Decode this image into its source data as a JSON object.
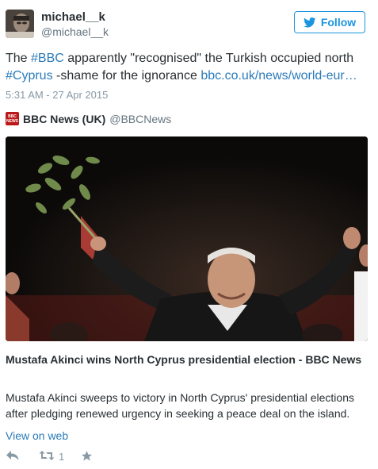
{
  "user": {
    "name": "michael__k",
    "handle": "@michael__k"
  },
  "follow_button": {
    "label": "Follow"
  },
  "tweet": {
    "text_1": "The ",
    "hashtag_bbc": "#BBC",
    "text_2": " apparently \"recognised\" the Turkish occupied north ",
    "hashtag_cyprus": "#Cyprus",
    "text_3": " -shame for the ignorance ",
    "link": "bbc.co.uk/news/world-eur…",
    "timestamp": "5:31 AM - 27 Apr 2015"
  },
  "source": {
    "logo_line1": "BBC",
    "logo_line2": "NEWS",
    "name": "BBC News (UK)",
    "handle": "@BBCNews"
  },
  "article": {
    "title": "Mustafa Akinci wins North Cyprus presidential election - BBC News",
    "description": "Mustafa Akinci sweeps to victory in North Cyprus' presidential elections after pledging renewed urgency in seeking a peace deal on the island.",
    "view_on_web": "View on web"
  },
  "actions": {
    "retweet_count": "1"
  },
  "icons": {
    "follow": "twitter-bird-icon",
    "reply": "reply-icon",
    "retweet": "retweet-icon",
    "favorite": "star-icon"
  },
  "colors": {
    "link": "#2b7bb9",
    "follow": "#1b95e0",
    "meta": "#8899a6",
    "bbc_red": "#bb1919"
  }
}
